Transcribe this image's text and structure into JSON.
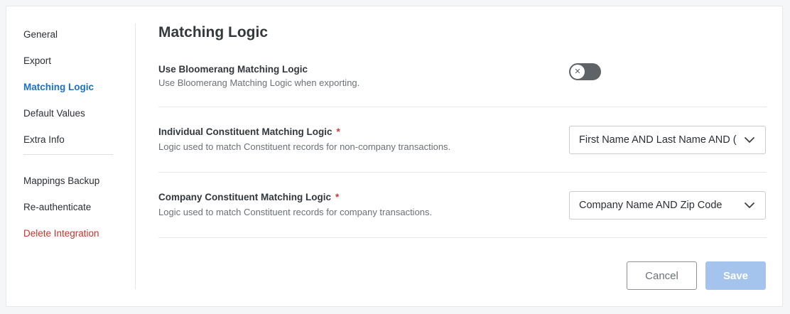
{
  "sidebar": {
    "items": [
      {
        "label": "General"
      },
      {
        "label": "Export"
      },
      {
        "label": "Matching Logic"
      },
      {
        "label": "Default Values"
      },
      {
        "label": "Extra Info"
      },
      {
        "label": "Mappings Backup"
      },
      {
        "label": "Re-authenticate"
      },
      {
        "label": "Delete Integration"
      }
    ],
    "active_item": "Matching Logic"
  },
  "main": {
    "title": "Matching Logic",
    "bloomerang_toggle": {
      "label": "Use Bloomerang Matching Logic",
      "description": "Use Bloomerang Matching Logic when exporting.",
      "enabled": false,
      "knob_icon": "x-icon"
    },
    "individual_logic": {
      "label": "Individual Constituent Matching Logic",
      "required_mark": "*",
      "description": "Logic used to match Constituent records for non-company transactions.",
      "selected": "First Name AND Last Name AND (",
      "icon": "chevron-down-icon"
    },
    "company_logic": {
      "label": "Company Constituent Matching Logic",
      "required_mark": "*",
      "description": "Logic used to match Constituent records for company transactions.",
      "selected": "Company Name AND Zip Code",
      "icon": "chevron-down-icon"
    },
    "actions": {
      "cancel_label": "Cancel",
      "save_label": "Save"
    }
  },
  "colors": {
    "accent": "#1e6fc5",
    "danger": "#c7352c",
    "required": "#d23a31",
    "save_disabled": "#a4c4ee",
    "toggle_off": "#5f6368"
  }
}
